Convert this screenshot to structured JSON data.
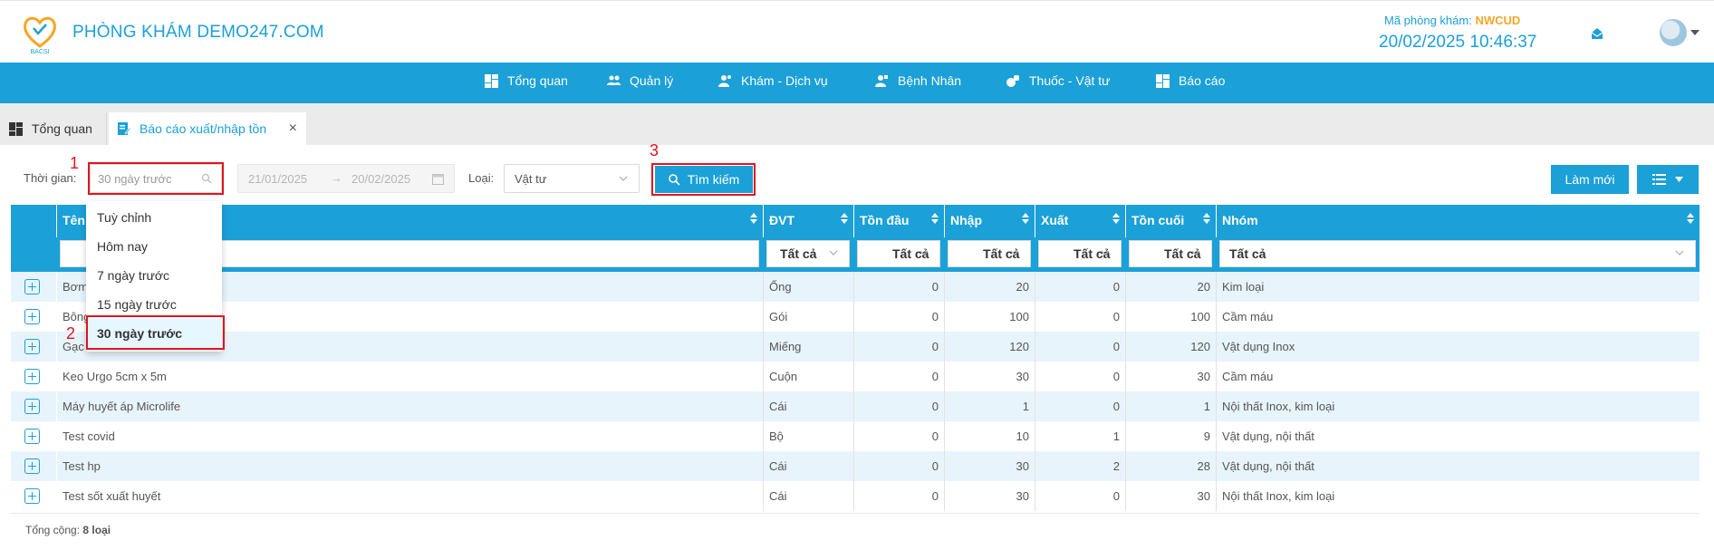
{
  "header": {
    "clinic_name": "PHÒNG KHÁM DEMO247.COM",
    "clinic_code_label": "Mã phòng khám:",
    "clinic_code": "NWCUD",
    "datetime": "20/02/2025 10:46:37"
  },
  "nav": {
    "items": [
      {
        "label": "Tổng quan",
        "icon": "dashboard-icon"
      },
      {
        "label": "Quản lý",
        "icon": "users-icon"
      },
      {
        "label": "Khám - Dịch vụ",
        "icon": "doctor-icon"
      },
      {
        "label": "Bệnh Nhân",
        "icon": "patient-icon"
      },
      {
        "label": "Thuốc - Vật tư",
        "icon": "medicine-icon"
      },
      {
        "label": "Báo cáo",
        "icon": "report-icon"
      }
    ]
  },
  "tabs": [
    {
      "label": "Tổng quan"
    },
    {
      "label": "Báo cáo xuất/nhập tồn"
    }
  ],
  "filters": {
    "time_label": "Thời gian:",
    "range_value": "30 ngày trước",
    "date_from": "21/01/2025",
    "date_to": "20/02/2025",
    "type_label": "Loại:",
    "type_value": "Vật tư",
    "search_button": "Tìm kiếm",
    "refresh_button": "Làm mới"
  },
  "dropdown": {
    "options": [
      "Tuỳ chỉnh",
      "Hôm nay",
      "7 ngày trước",
      "15 ngày trước",
      "30 ngày trước"
    ],
    "selected": "30 ngày trước"
  },
  "annotations": [
    "1",
    "2",
    "3"
  ],
  "table": {
    "columns": [
      "Tên",
      "ĐVT",
      "Tồn đầu",
      "Nhập",
      "Xuất",
      "Tồn cuối",
      "Nhóm"
    ],
    "filter_all": "Tất cả",
    "rows": [
      {
        "name": "Bơm",
        "unit": "Ống",
        "open": "0",
        "in": "20",
        "out": "0",
        "close": "20",
        "group": "Kim loại"
      },
      {
        "name": "Bông",
        "unit": "Gói",
        "open": "0",
        "in": "100",
        "out": "0",
        "close": "100",
        "group": "Cầm máu"
      },
      {
        "name": "Gạc",
        "unit": "Miếng",
        "open": "0",
        "in": "120",
        "out": "0",
        "close": "120",
        "group": "Vật dụng Inox"
      },
      {
        "name": "Keo Urgo 5cm x 5m",
        "unit": "Cuộn",
        "open": "0",
        "in": "30",
        "out": "0",
        "close": "30",
        "group": "Cầm máu"
      },
      {
        "name": "Máy huyết áp Microlife",
        "unit": "Cái",
        "open": "0",
        "in": "1",
        "out": "0",
        "close": "1",
        "group": "Nội thất Inox, kim loại"
      },
      {
        "name": "Test covid",
        "unit": "Bộ",
        "open": "0",
        "in": "10",
        "out": "1",
        "close": "9",
        "group": "Vật dụng, nội thất"
      },
      {
        "name": "Test hp",
        "unit": "Cái",
        "open": "0",
        "in": "30",
        "out": "2",
        "close": "28",
        "group": "Vật dụng, nội thất"
      },
      {
        "name": "Test sốt xuất huyết",
        "unit": "Cái",
        "open": "0",
        "in": "30",
        "out": "0",
        "close": "30",
        "group": "Nội thất Inox, kim loại"
      }
    ],
    "footer_label": "Tổng cộng:",
    "footer_count": "8 loại"
  },
  "colors": {
    "primary": "#1ba0d8",
    "accent": "#f5a623",
    "annotation": "#e0141e"
  }
}
